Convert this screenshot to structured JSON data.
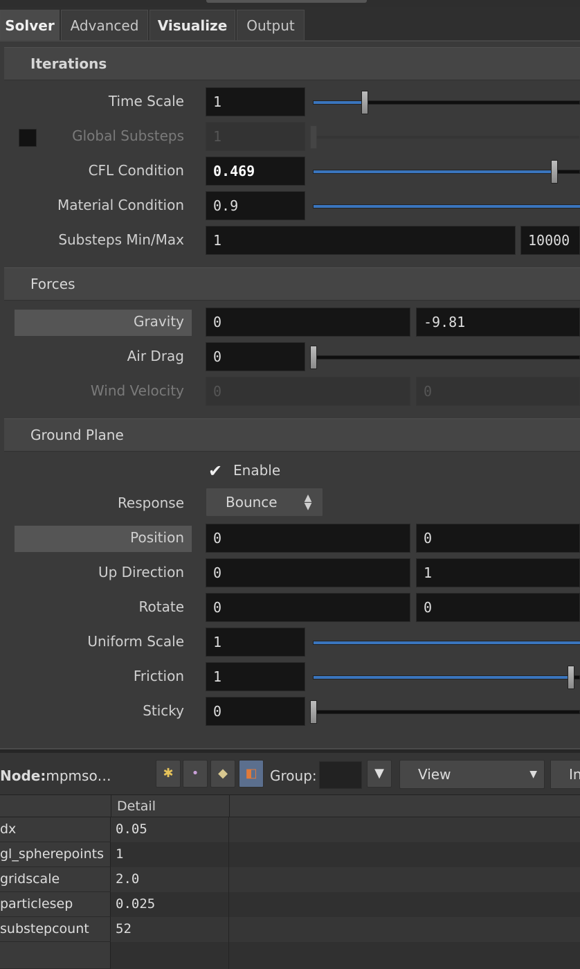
{
  "tabs": [
    {
      "label": "Solver"
    },
    {
      "label": "Advanced"
    },
    {
      "label": "Visualize"
    },
    {
      "label": "Output"
    }
  ],
  "iterations": {
    "title": "Iterations",
    "time_scale": {
      "label": "Time Scale",
      "value": "1",
      "slider_fraction": 0.2
    },
    "global_substeps": {
      "label": "Global Substeps",
      "value": "1"
    },
    "cfl_condition": {
      "label": "CFL Condition",
      "value": "0.469",
      "slider_fraction": 0.9
    },
    "material_condition": {
      "label": "Material Condition",
      "value": "0.9"
    },
    "substeps_minmax": {
      "label": "Substeps Min/Max",
      "min": "1",
      "max": "10000"
    }
  },
  "forces": {
    "title": "Forces",
    "gravity": {
      "label": "Gravity",
      "x": "0",
      "y": "-9.81"
    },
    "air_drag": {
      "label": "Air Drag",
      "value": "0",
      "slider_fraction": 0.0
    },
    "wind_velocity": {
      "label": "Wind Velocity",
      "x": "0",
      "y": "0"
    }
  },
  "ground_plane": {
    "title": "Ground Plane",
    "enable": {
      "label": "Enable",
      "checked": true
    },
    "response": {
      "label": "Response",
      "value": "Bounce"
    },
    "position": {
      "label": "Position",
      "x": "0",
      "y": "0"
    },
    "up_direction": {
      "label": "Up Direction",
      "x": "0",
      "y": "1"
    },
    "rotate": {
      "label": "Rotate",
      "x": "0",
      "y": "0"
    },
    "uniform_scale": {
      "label": "Uniform Scale",
      "value": "1"
    },
    "friction": {
      "label": "Friction",
      "value": "1",
      "slider_fraction": 0.97
    },
    "sticky": {
      "label": "Sticky",
      "value": "0",
      "slider_fraction": 0.0
    }
  },
  "spreadsheet_toolbar": {
    "node_label": "Node:",
    "node_name": "mpmso…",
    "group_label": "Group:",
    "view_label": "View",
    "info_label": "In"
  },
  "spreadsheet": {
    "column_header": "Detail",
    "rows": [
      {
        "name": "dx",
        "value": "0.05"
      },
      {
        "name": "gl_spherepoints",
        "value": "1"
      },
      {
        "name": "gridscale",
        "value": "2.0"
      },
      {
        "name": "particlesep",
        "value": "0.025"
      },
      {
        "name": "substepcount",
        "value": "52"
      }
    ]
  },
  "colors": {
    "accent": "#3a75bd",
    "background": "#3a3a3a",
    "field": "#151515"
  }
}
